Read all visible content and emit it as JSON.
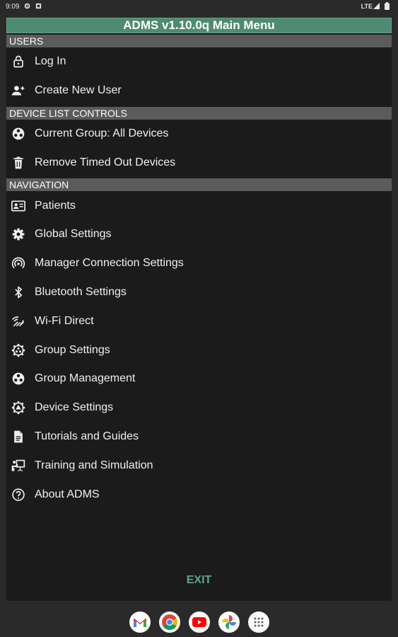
{
  "status_bar": {
    "time": "9:09",
    "network": "LTE"
  },
  "title": "ADMS v1.10.0q Main Menu",
  "sections": {
    "users": {
      "label": "USERS",
      "items": [
        {
          "label": "Log In",
          "icon": "lock-icon"
        },
        {
          "label": "Create New User",
          "icon": "add-user-icon"
        }
      ]
    },
    "device_list": {
      "label": "DEVICE LIST CONTROLS",
      "items": [
        {
          "label": "Current Group: All Devices",
          "icon": "group-icon"
        },
        {
          "label": "Remove Timed Out Devices",
          "icon": "trash-icon"
        }
      ]
    },
    "navigation": {
      "label": "NAVIGATION",
      "items": [
        {
          "label": "Patients",
          "icon": "id-card-icon"
        },
        {
          "label": "Global Settings",
          "icon": "gear-icon"
        },
        {
          "label": "Manager Connection Settings",
          "icon": "broadcast-icon"
        },
        {
          "label": "Bluetooth Settings",
          "icon": "bluetooth-icon"
        },
        {
          "label": "Wi-Fi Direct",
          "icon": "wifi-direct-icon"
        },
        {
          "label": "Group Settings",
          "icon": "group-settings-icon"
        },
        {
          "label": "Group Management",
          "icon": "group-icon"
        },
        {
          "label": "Device Settings",
          "icon": "device-settings-icon"
        },
        {
          "label": "Tutorials and Guides",
          "icon": "document-icon"
        },
        {
          "label": "Training and Simulation",
          "icon": "training-icon"
        },
        {
          "label": "About ADMS",
          "icon": "help-icon"
        }
      ]
    }
  },
  "exit_label": "EXIT",
  "dock": [
    {
      "icon": "gmail-icon"
    },
    {
      "icon": "chrome-icon"
    },
    {
      "icon": "youtube-icon"
    },
    {
      "icon": "photos-icon"
    },
    {
      "icon": "app-drawer-icon"
    }
  ],
  "colors": {
    "accent": "#4f8a73",
    "section_bg": "#5b5b5b",
    "panel_bg": "#1b1b1b",
    "exit": "#5fa787"
  }
}
